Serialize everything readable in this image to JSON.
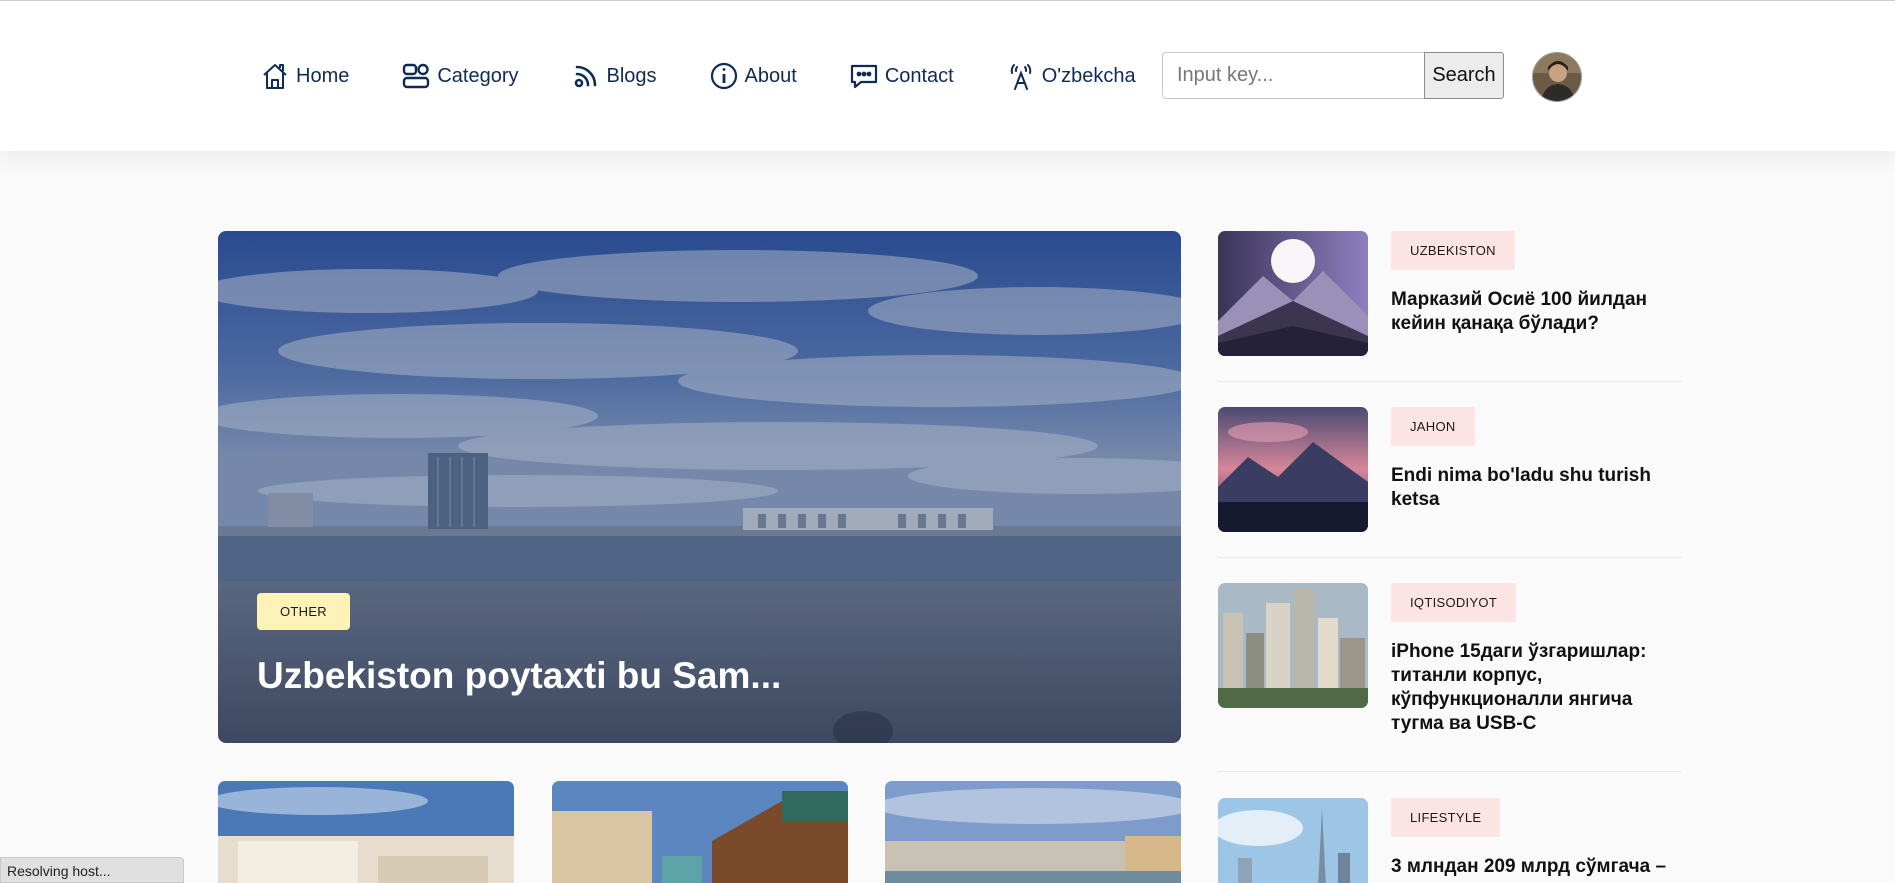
{
  "nav": {
    "items": [
      {
        "label": "Home",
        "icon": "home-icon"
      },
      {
        "label": "Category",
        "icon": "category-icon"
      },
      {
        "label": "Blogs",
        "icon": "blogs-icon"
      },
      {
        "label": "About",
        "icon": "info-icon"
      },
      {
        "label": "Contact",
        "icon": "chat-icon"
      },
      {
        "label": "O'zbekcha",
        "icon": "language-icon"
      }
    ]
  },
  "search": {
    "placeholder": "Input key...",
    "value": "",
    "button_label": "Search"
  },
  "hero": {
    "category": "OTHER",
    "title": "Uzbekiston poytaxti bu Sam..."
  },
  "side_posts": [
    {
      "category": "UZBEKISTON",
      "title": "Марказий Осиё 100 йилдан кейин қанақа бўлади?"
    },
    {
      "category": "JAHON",
      "title": "Endi nima bo'ladu shu turish ketsa"
    },
    {
      "category": "IQTISODIYOT",
      "title": "iPhone 15даги ўзгаришлар: титанли корпус, кўпфункционалли янгича тугма ва USB-C"
    },
    {
      "category": "LIFESTYLE",
      "title": "3 млндан 209 млрд сўмгача –"
    }
  ],
  "status_bar": {
    "text": "Resolving host..."
  },
  "colors": {
    "nav_text": "#0f2b55",
    "hero_badge_bg": "#fdf2b8",
    "side_badge_bg": "#fde4e4"
  }
}
